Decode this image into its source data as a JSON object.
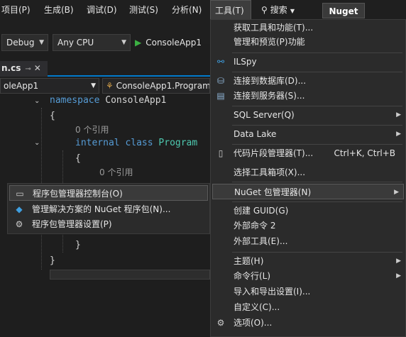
{
  "menubar": {
    "items": [
      {
        "label": "项目(P)"
      },
      {
        "label": "生成(B)"
      },
      {
        "label": "调试(D)"
      },
      {
        "label": "测试(S)"
      },
      {
        "label": "分析(N)"
      },
      {
        "label": "工具(T)"
      }
    ],
    "search_label": "搜索",
    "nuget_badge": "Nuget"
  },
  "toolbar": {
    "config": "Debug",
    "platform": "Any CPU",
    "run_label": "ConsoleApp1"
  },
  "tab": {
    "label": "n.cs",
    "pin": "⊸",
    "close": "✕"
  },
  "navbar": {
    "project": "oleApp1",
    "class": "ConsoleApp1.Program"
  },
  "code": {
    "namespace_kw": "namespace",
    "namespace_name": "ConsoleApp1",
    "open_brace": "{",
    "close_brace": "}",
    "refs1": "0 个引用",
    "internal_kw": "internal",
    "class_kw": "class",
    "class_name": "Program",
    "refs2": "0 个引用"
  },
  "submenu": {
    "items": [
      {
        "label": "程序包管理器控制台(O)",
        "icon": "console-icon",
        "glyph": "▭"
      },
      {
        "label": "管理解决方案的 NuGet 程序包(N)...",
        "icon": "nuget-icon",
        "glyph": "◆"
      },
      {
        "label": "程序包管理器设置(P)",
        "icon": "gear-icon",
        "glyph": "⚙"
      }
    ]
  },
  "tools_menu": {
    "items": [
      {
        "label": "获取工具和功能(T)...",
        "shortcut": "",
        "submenu": false,
        "icon": "",
        "glyph": ""
      },
      {
        "label": "管理和预览(P)功能",
        "shortcut": "",
        "submenu": false,
        "icon": "",
        "glyph": ""
      },
      {
        "label": "ILSpy",
        "shortcut": "",
        "submenu": false,
        "icon": "ilspy-icon",
        "glyph": "⚯"
      },
      {
        "label": "连接到数据库(D)...",
        "shortcut": "",
        "submenu": false,
        "icon": "database-icon",
        "glyph": "⛁"
      },
      {
        "label": "连接到服务器(S)...",
        "shortcut": "",
        "submenu": false,
        "icon": "server-icon",
        "glyph": "▤"
      },
      {
        "label": "SQL Server(Q)",
        "shortcut": "",
        "submenu": true,
        "icon": "",
        "glyph": ""
      },
      {
        "label": "Data Lake",
        "shortcut": "",
        "submenu": true,
        "icon": "",
        "glyph": ""
      },
      {
        "label": "代码片段管理器(T)...",
        "shortcut": "Ctrl+K, Ctrl+B",
        "submenu": false,
        "icon": "snippet-icon",
        "glyph": "▯"
      },
      {
        "label": "选择工具箱项(X)...",
        "shortcut": "",
        "submenu": false,
        "icon": "",
        "glyph": ""
      },
      {
        "label": "NuGet 包管理器(N)",
        "shortcut": "",
        "submenu": true,
        "icon": "",
        "glyph": ""
      },
      {
        "label": "创建 GUID(G)",
        "shortcut": "",
        "submenu": false,
        "icon": "",
        "glyph": ""
      },
      {
        "label": "外部命令 2",
        "shortcut": "",
        "submenu": false,
        "icon": "",
        "glyph": ""
      },
      {
        "label": "外部工具(E)...",
        "shortcut": "",
        "submenu": false,
        "icon": "",
        "glyph": ""
      },
      {
        "label": "主题(H)",
        "shortcut": "",
        "submenu": true,
        "icon": "",
        "glyph": ""
      },
      {
        "label": "命令行(L)",
        "shortcut": "",
        "submenu": true,
        "icon": "",
        "glyph": ""
      },
      {
        "label": "导入和导出设置(I)...",
        "shortcut": "",
        "submenu": false,
        "icon": "",
        "glyph": ""
      },
      {
        "label": "自定义(C)...",
        "shortcut": "",
        "submenu": false,
        "icon": "",
        "glyph": ""
      },
      {
        "label": "选项(O)...",
        "shortcut": "",
        "submenu": false,
        "icon": "gear-icon",
        "glyph": "⚙"
      }
    ]
  },
  "colors": {
    "accent": "#007acc",
    "run_green": "#3cb043",
    "keyword": "#569cd6",
    "type": "#4ec9b0"
  }
}
